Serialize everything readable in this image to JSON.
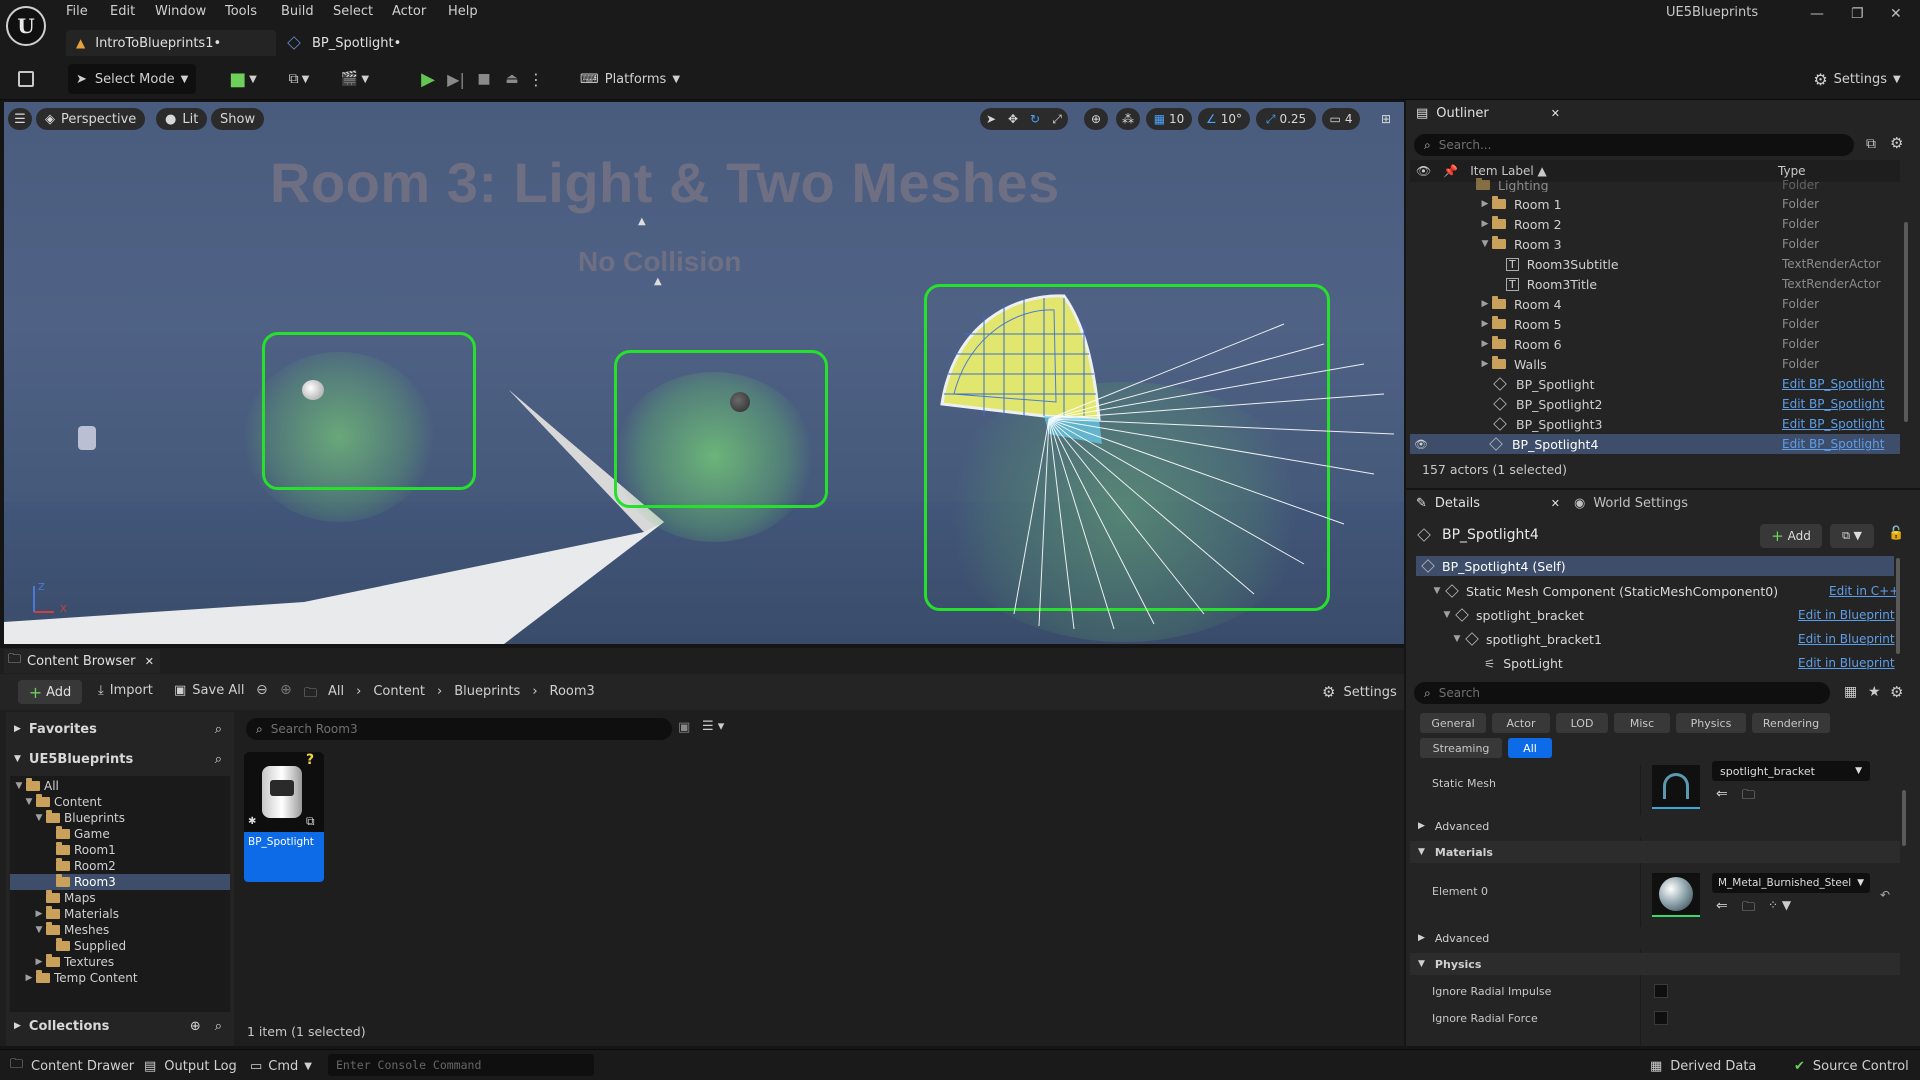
{
  "app": {
    "project_name": "UE5Blueprints",
    "menu": [
      "File",
      "Edit",
      "Window",
      "Tools",
      "Build",
      "Select",
      "Actor",
      "Help"
    ],
    "tabs": [
      {
        "label": "IntroToBlueprints1•",
        "active": true
      },
      {
        "label": "BP_Spotlight•",
        "active": false
      }
    ]
  },
  "toolbar": {
    "select_mode": "Select Mode",
    "platforms": "Platforms",
    "settings": "Settings"
  },
  "viewport": {
    "perspective": "Perspective",
    "lit": "Lit",
    "show": "Show",
    "grid_snap": "10",
    "rotation_snap": "10°",
    "scale_snap": "0.25",
    "camera_speed": "4",
    "scene_title": "Room 3: Light & Two Meshes",
    "scene_subtitle": "No Collision",
    "axis_z": "Z",
    "axis_x": "X"
  },
  "outliner": {
    "tab": "Outliner",
    "search_placeholder": "Search...",
    "col_label": "Item Label ▲",
    "col_type": "Type",
    "rows": [
      {
        "label": "Lighting",
        "type": "Folder"
      },
      {
        "label": "Room 1",
        "type": "Folder"
      },
      {
        "label": "Room 2",
        "type": "Folder"
      },
      {
        "label": "Room 3",
        "type": "Folder"
      },
      {
        "label": "Room3Subtitle",
        "type": "TextRenderActor"
      },
      {
        "label": "Room3Title",
        "type": "TextRenderActor"
      },
      {
        "label": "Room 4",
        "type": "Folder"
      },
      {
        "label": "Room 5",
        "type": "Folder"
      },
      {
        "label": "Room 6",
        "type": "Folder"
      },
      {
        "label": "Walls",
        "type": "Folder"
      },
      {
        "label": "BP_Spotlight",
        "type": "Edit BP_Spotlight"
      },
      {
        "label": "BP_Spotlight2",
        "type": "Edit BP_Spotlight"
      },
      {
        "label": "BP_Spotlight3",
        "type": "Edit BP_Spotlight"
      },
      {
        "label": "BP_Spotlight4",
        "type": "Edit BP_Spotlight"
      }
    ],
    "footer": "157 actors (1 selected)"
  },
  "details": {
    "tab": "Details",
    "world_settings_tab": "World Settings",
    "actor_name": "BP_Spotlight4",
    "add": "Add",
    "components": [
      {
        "label": "BP_Spotlight4 (Self)",
        "link": ""
      },
      {
        "label": "Static Mesh Component (StaticMeshComponent0)",
        "link": "Edit in C++"
      },
      {
        "label": "spotlight_bracket",
        "link": "Edit in Blueprint"
      },
      {
        "label": "spotlight_bracket1",
        "link": "Edit in Blueprint"
      },
      {
        "label": "SpotLight",
        "link": "Edit in Blueprint"
      }
    ],
    "search_placeholder": "Search",
    "categories": [
      "General",
      "Actor",
      "LOD",
      "Misc",
      "Physics",
      "Rendering",
      "Streaming",
      "All"
    ],
    "static_mesh_label": "Static Mesh",
    "static_mesh_value": "spotlight_bracket",
    "advanced": "Advanced",
    "materials": "Materials",
    "element0_label": "Element 0",
    "element0_value": "M_Metal_Burnished_Steel",
    "advanced2": "Advanced",
    "physics": "Physics",
    "ignore_radial_impulse": "Ignore Radial Impulse",
    "ignore_radial_force": "Ignore Radial Force"
  },
  "content_browser": {
    "tab": "Content Browser",
    "add": "Add",
    "import": "Import",
    "save_all": "Save All",
    "breadcrumb": [
      "All",
      "Content",
      "Blueprints",
      "Room3"
    ],
    "settings": "Settings",
    "favorites": "Favorites",
    "project": "UE5Blueprints",
    "search_placeholder": "Search Room3",
    "tree": [
      {
        "label": "All",
        "level": 0
      },
      {
        "label": "Content",
        "level": 1
      },
      {
        "label": "Blueprints",
        "level": 2
      },
      {
        "label": "Game",
        "level": 3
      },
      {
        "label": "Room1",
        "level": 3
      },
      {
        "label": "Room2",
        "level": 3
      },
      {
        "label": "Room3",
        "level": 3
      },
      {
        "label": "Maps",
        "level": 2
      },
      {
        "label": "Materials",
        "level": 2
      },
      {
        "label": "Meshes",
        "level": 2
      },
      {
        "label": "Supplied",
        "level": 3
      },
      {
        "label": "Textures",
        "level": 2
      },
      {
        "label": "Temp Content",
        "level": 1
      }
    ],
    "asset_name": "BP_Spotlight",
    "collections": "Collections",
    "status": "1 item (1 selected)"
  },
  "statusbar": {
    "content_drawer": "Content Drawer",
    "output_log": "Output Log",
    "cmd": "Cmd",
    "console_placeholder": "Enter Console Command",
    "derived_data": "Derived Data",
    "source_control": "Source Control"
  },
  "colors": {
    "selection_green": "#26e02c",
    "link_blue": "#5e9ee8",
    "accent_blue": "#0e6be8",
    "folder": "#c9a15b"
  }
}
